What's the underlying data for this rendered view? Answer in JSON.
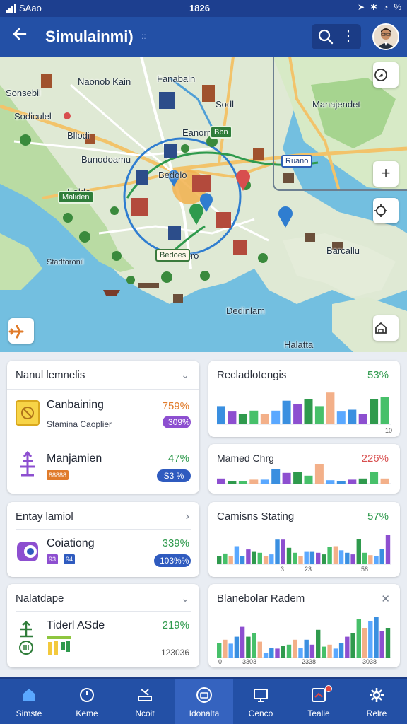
{
  "status_bar": {
    "carrier": "SAao",
    "time": "1826",
    "battery": "%"
  },
  "app_bar": {
    "title": "Simulainmi)",
    "title_suffix": "::"
  },
  "map": {
    "labels": [
      "Naonob Kain",
      "Fanabaln",
      "Sonsebil",
      "Sodl",
      "Manajendet",
      "Sodiculel",
      "Bllodi",
      "Bunodoamu",
      "Eanorn",
      "Bedolo",
      "Ealdo",
      "Baandoro",
      "Barcallu",
      "Dedinlam",
      "Stadforonil",
      "Halatta"
    ],
    "badges": [
      "Bbn",
      "Maliden",
      "Ruano",
      "Bedoes"
    ]
  },
  "cards": {
    "left1": {
      "title": "Nanul lemnelis",
      "items": [
        {
          "name": "Canbaining",
          "sub": "Stamina Caoplier",
          "pct": "759%",
          "pill": "309%"
        },
        {
          "name": "Manjamien",
          "tag": "88888",
          "pct": "47%",
          "pill": "S3 %"
        }
      ]
    },
    "left2": {
      "title": "Entay lamiol",
      "items": [
        {
          "name": "Coiationg",
          "tag1": "93",
          "tag2": "94",
          "pct": "339%",
          "pill": "103%%"
        }
      ]
    },
    "left3": {
      "title": "Nalatdape",
      "items": [
        {
          "name": "Tiderl ASde",
          "pct": "219%",
          "sub": "123036"
        }
      ]
    },
    "right1": {
      "title": "Recladlotengis",
      "pct": "53%"
    },
    "right2": {
      "title": "Mamed Chrg",
      "pct": "226%"
    },
    "right3": {
      "title": "Camisns Stating",
      "pct": "57%"
    },
    "right4": {
      "title": "Blanebolar Radem"
    }
  },
  "chart_data": [
    {
      "type": "bar",
      "title": "Recladlotengis",
      "values": [
        40,
        28,
        22,
        30,
        22,
        30,
        52,
        45,
        55,
        40,
        70,
        28,
        32,
        22,
        55,
        60
      ],
      "ylim": [
        0,
        100
      ],
      "tick_labels": [
        "10"
      ]
    },
    {
      "type": "bar",
      "title": "Mamed Chrg",
      "values": [
        18,
        10,
        10,
        14,
        14,
        50,
        38,
        42,
        28,
        70,
        12,
        10,
        14,
        18,
        40,
        18
      ],
      "ylim": [
        0,
        100
      ]
    },
    {
      "type": "bar",
      "title": "Camisns Stating",
      "values": [
        20,
        26,
        20,
        44,
        20,
        36,
        30,
        28,
        20,
        24,
        60,
        60,
        40,
        28,
        20,
        30,
        30,
        28,
        24,
        42,
        44,
        34,
        28,
        24,
        62,
        28,
        22,
        20,
        38,
        72
      ],
      "ylim": [
        0,
        100
      ],
      "tick_labels": [
        "3",
        "23",
        "58"
      ]
    },
    {
      "type": "bar",
      "title": "Blanebolar Radem",
      "values": [
        30,
        36,
        28,
        42,
        62,
        42,
        50,
        32,
        10,
        20,
        18,
        24,
        26,
        36,
        20,
        36,
        26,
        56,
        22,
        26,
        18,
        30,
        42,
        50,
        78,
        60,
        74,
        82,
        54,
        60
      ],
      "ylim": [
        0,
        100
      ],
      "tick_labels": [
        "0",
        "3303",
        "2338",
        "3038"
      ]
    }
  ],
  "bottom_nav": [
    {
      "label": "Simste",
      "icon": "home-icon"
    },
    {
      "label": "Keme",
      "icon": "clock-icon"
    },
    {
      "label": "Ncoit",
      "icon": "tray-icon"
    },
    {
      "label": "Idonalta",
      "icon": "timer-icon"
    },
    {
      "label": "Cenco",
      "icon": "screen-icon"
    },
    {
      "label": "Tealie",
      "icon": "alert-box-icon"
    },
    {
      "label": "Relre",
      "icon": "gear-icon"
    }
  ],
  "colors": {
    "primary": "#2350a6",
    "accent_green": "#2f9a4d",
    "accent_orange": "#e07b2a",
    "accent_red": "#d84e4e"
  }
}
